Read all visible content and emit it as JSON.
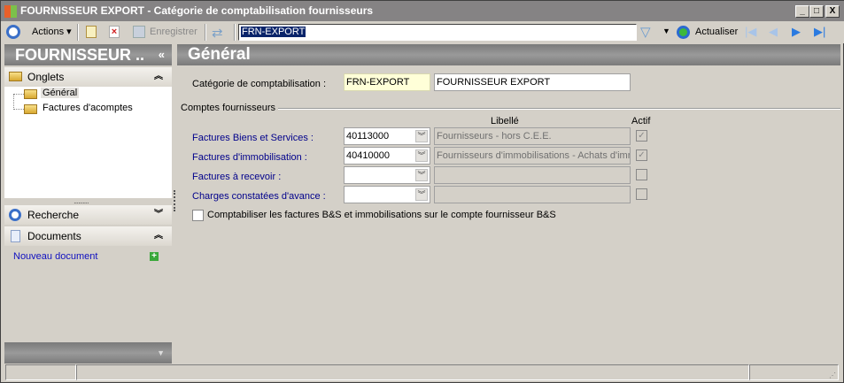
{
  "window": {
    "title": "FOURNISSEUR EXPORT -  Catégorie de comptabilisation fournisseurs",
    "minimize": "_",
    "maximize": "□",
    "close": "X"
  },
  "toolbar": {
    "actions": "Actions",
    "save": "Enregistrer",
    "search_value": "FRN-EXPORT",
    "refresh": "Actualiser"
  },
  "sidebar": {
    "title": "FOURNISSEUR ..",
    "collapse": "«",
    "onglets": "Onglets",
    "tree": [
      "Général",
      "Factures d'acomptes"
    ],
    "recherche": "Recherche",
    "documents": "Documents",
    "new_document": "Nouveau document"
  },
  "main": {
    "title": "Général",
    "category_label": "Catégorie de comptabilisation :",
    "category_code": "FRN-EXPORT",
    "category_name": "FOURNISSEUR EXPORT",
    "group": "Comptes fournisseurs",
    "col_libelle": "Libellé",
    "col_actif": "Actif",
    "rows": [
      {
        "label": "Factures Biens et Services :",
        "account": "40113000",
        "libelle": "Fournisseurs - hors C.E.E.",
        "actif": true
      },
      {
        "label": "Factures d'immobilisation :",
        "account": "40410000",
        "libelle": "Fournisseurs d'immobilisations - Achats d'immo",
        "actif": true
      },
      {
        "label": "Factures à recevoir :",
        "account": "",
        "libelle": "",
        "actif": false
      },
      {
        "label": "Charges constatées d'avance :",
        "account": "",
        "libelle": "",
        "actif": false
      }
    ],
    "option": "Comptabiliser les factures B&S et immobilisations sur le compte fournisseur B&S"
  }
}
